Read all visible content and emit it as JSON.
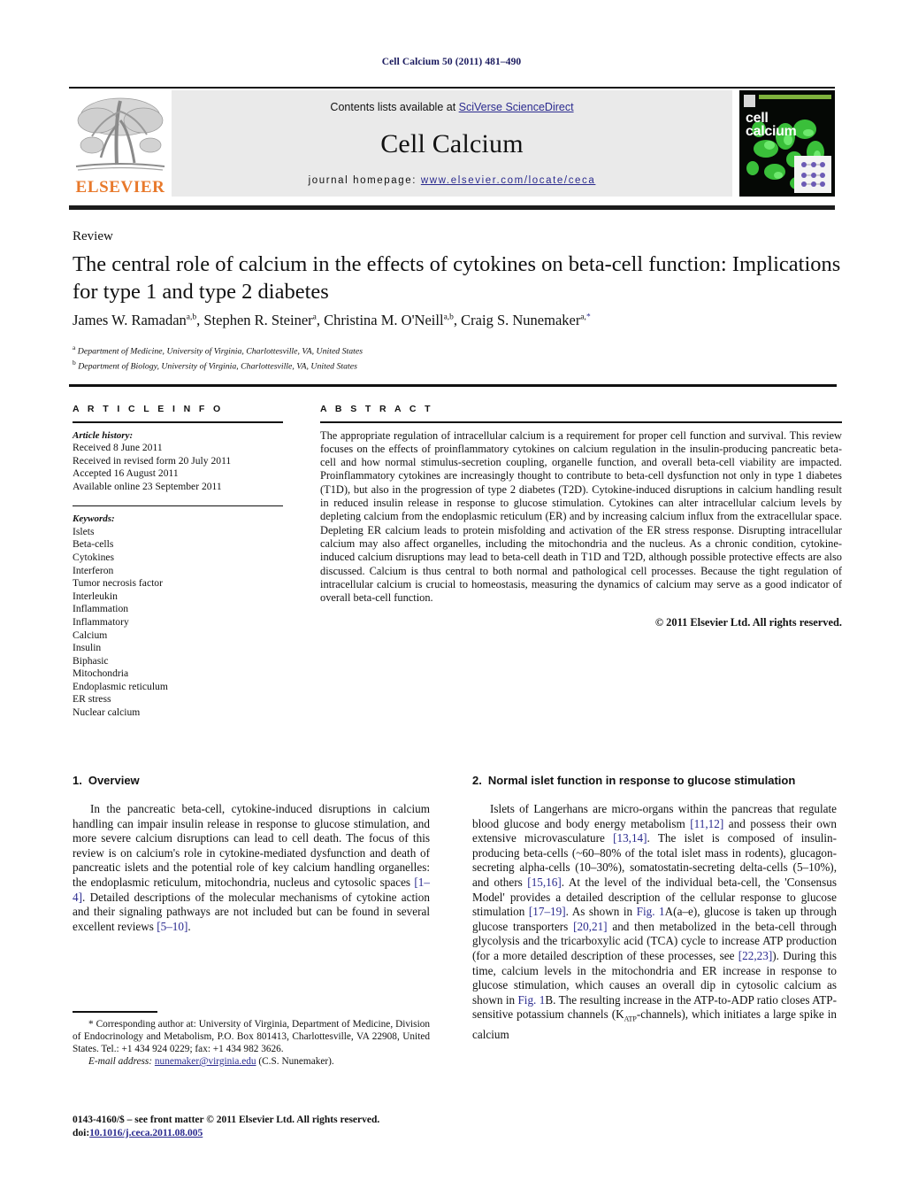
{
  "running_head": "Cell Calcium 50 (2011) 481–490",
  "masthead": {
    "publisher_wordmark": "ELSEVIER",
    "contents_prefix": "Contents lists available at ",
    "contents_link": "SciVerse ScienceDirect",
    "journal_name": "Cell Calcium",
    "homepage_prefix": "journal homepage: ",
    "homepage_link": "www.elsevier.com/locate/ceca",
    "cover_title_line1": "cell",
    "cover_title_line2": "calcium"
  },
  "article": {
    "type": "Review",
    "title": "The central role of calcium in the effects of cytokines on beta-cell function: Implications for type 1 and type 2 diabetes",
    "authors_html": "James W. Ramadan<sup>a,b</sup>, Stephen R. Steiner<sup>a</sup>, Christina M. O'Neill<sup>a,b</sup>, Craig S. Nunemaker<sup>a,<span class=\"star\">*</span></sup>",
    "affiliation_a": "Department of Medicine, University of Virginia, Charlottesville, VA, United States",
    "affiliation_b": "Department of Biology, University of Virginia, Charlottesville, VA, United States"
  },
  "article_info": {
    "heading": "A R T I C L E   I N F O",
    "history_label": "Article history:",
    "history": [
      "Received 8 June 2011",
      "Received in revised form 20 July 2011",
      "Accepted 16 August 2011",
      "Available online 23 September 2011"
    ],
    "keywords_label": "Keywords:",
    "keywords": [
      "Islets",
      "Beta-cells",
      "Cytokines",
      "Interferon",
      "Tumor necrosis factor",
      "Interleukin",
      "Inflammation",
      "Inflammatory",
      "Calcium",
      "Insulin",
      "Biphasic",
      "Mitochondria",
      "Endoplasmic reticulum",
      "ER stress",
      "Nuclear calcium"
    ]
  },
  "abstract": {
    "heading": "A B S T R A C T",
    "text": "The appropriate regulation of intracellular calcium is a requirement for proper cell function and survival. This review focuses on the effects of proinflammatory cytokines on calcium regulation in the insulin-producing pancreatic beta-cell and how normal stimulus-secretion coupling, organelle function, and overall beta-cell viability are impacted. Proinflammatory cytokines are increasingly thought to contribute to beta-cell dysfunction not only in type 1 diabetes (T1D), but also in the progression of type 2 diabetes (T2D). Cytokine-induced disruptions in calcium handling result in reduced insulin release in response to glucose stimulation. Cytokines can alter intracellular calcium levels by depleting calcium from the endoplasmic reticulum (ER) and by increasing calcium influx from the extracellular space. Depleting ER calcium leads to protein misfolding and activation of the ER stress response. Disrupting intracellular calcium may also affect organelles, including the mitochondria and the nucleus. As a chronic condition, cytokine-induced calcium disruptions may lead to beta-cell death in T1D and T2D, although possible protective effects are also discussed. Calcium is thus central to both normal and pathological cell processes. Because the tight regulation of intracellular calcium is crucial to homeostasis, measuring the dynamics of calcium may serve as a good indicator of overall beta-cell function.",
    "copyright": "© 2011 Elsevier Ltd. All rights reserved."
  },
  "sections": {
    "overview": {
      "number": "1.",
      "title": "Overview",
      "paragraph_html": "In the pancreatic beta-cell, cytokine-induced disruptions in calcium handling can impair insulin release in response to glucose stimulation, and more severe calcium disruptions can lead to cell death. The focus of this review is on calcium's role in cytokine-mediated dysfunction and death of pancreatic islets and the potential role of key calcium handling organelles: the endoplasmic reticulum, mitochondria, nucleus and cytosolic spaces <span class=\"ref\">[1–4]</span>. Detailed descriptions of the molecular mechanisms of cytokine action and their signaling pathways are not included but can be found in several excellent reviews <span class=\"ref\">[5–10]</span>."
    },
    "normal_islet": {
      "number": "2.",
      "title": "Normal islet function in response to glucose stimulation",
      "paragraph_html": "Islets of Langerhans are micro-organs within the pancreas that regulate blood glucose and body energy metabolism <span class=\"ref\">[11,12]</span> and possess their own extensive microvasculature <span class=\"ref\">[13,14]</span>. The islet is composed of insulin-producing beta-cells (~60–80% of the total islet mass in rodents), glucagon-secreting alpha-cells (10–30%), somatostatin-secreting delta-cells (5–10%), and others <span class=\"ref\">[15,16]</span>. At the level of the individual beta-cell, the 'Consensus Model' provides a detailed description of the cellular response to glucose stimulation <span class=\"ref\">[17–19]</span>. As shown in <span class=\"ref\">Fig. 1</span>A(a–e), glucose is taken up through glucose transporters <span class=\"ref\">[20,21]</span> and then metabolized in the beta-cell through glycolysis and the tricarboxylic acid (TCA) cycle to increase ATP production (for a more detailed description of these processes, see <span class=\"ref\">[22,23]</span>). During this time, calcium levels in the mitochondria and ER increase in response to glucose stimulation, which causes an overall dip in cytosolic calcium as shown in <span class=\"ref\">Fig. 1</span>B. The resulting increase in the ATP-to-ADP ratio closes ATP-sensitive potassium channels (K<sub>ATP</sub>-channels), which initiates a large spike in calcium"
    }
  },
  "footnotes": {
    "corresponding_html": "<span class=\"fn-indent\">* Corresponding author at: University of Virginia, Department of Medicine, Division of Endocrinology and Metabolism, P.O. Box 801413, Charlottesville, VA 22908, United States. Tel.: +1 434 924 0229; fax: +1 434 982 3626.</span>",
    "email_label": "E-mail address:",
    "email_link": "nunemaker@virginia.edu",
    "email_suffix": " (C.S. Nunemaker).",
    "issn_line": "0143-4160/$ – see front matter © 2011 Elsevier Ltd. All rights reserved.",
    "doi_prefix": "doi:",
    "doi_value": "10.1016/j.ceca.2011.08.005"
  },
  "colors": {
    "header_navy": "#1a1a5e",
    "link_blue": "#2b2b8f",
    "elsevier_orange": "#e8792b",
    "band_gray": "#eaeaea"
  }
}
